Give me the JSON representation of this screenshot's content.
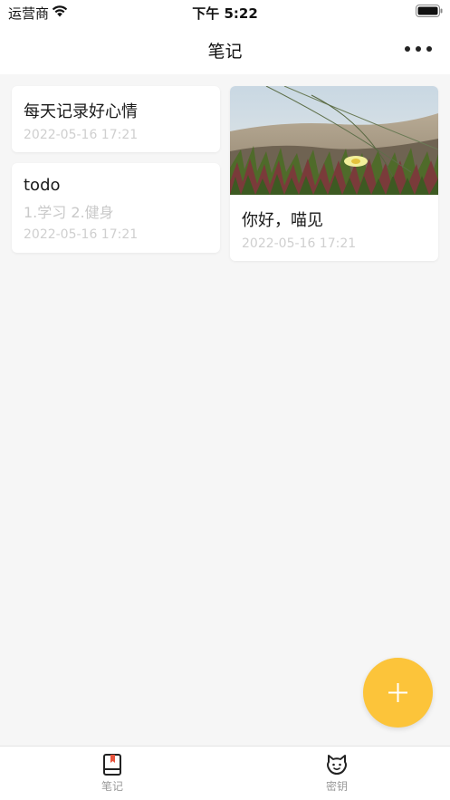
{
  "status_bar": {
    "carrier": "运营商",
    "time": "下午 5:22"
  },
  "header": {
    "title": "笔记",
    "more_icon": "ellipsis-icon"
  },
  "notes": [
    {
      "title": "每天记录好心情",
      "content": "",
      "date": "2022-05-16 17:21"
    },
    {
      "title": "todo",
      "content": "1.学习 2.健身",
      "date": "2022-05-16 17:21"
    },
    {
      "title": "你好，喵见",
      "content": "",
      "date": "2022-05-16 17:21",
      "image": "succulent-flower-photo"
    }
  ],
  "fab": {
    "icon": "plus-icon",
    "color": "#fcc43a"
  },
  "tab_bar": {
    "items": [
      {
        "label": "笔记",
        "icon": "notebook-icon"
      },
      {
        "label": "密钥",
        "icon": "cat-face-icon"
      }
    ]
  }
}
